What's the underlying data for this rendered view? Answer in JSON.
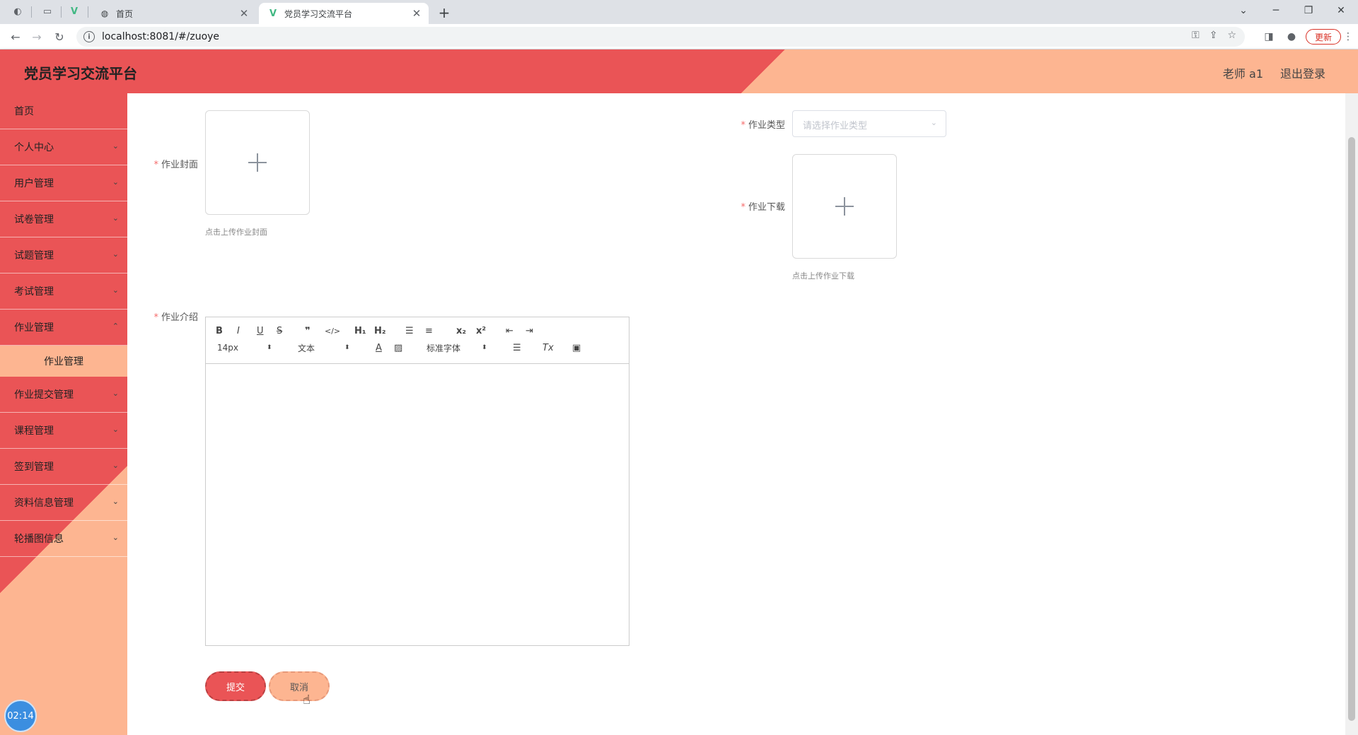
{
  "browser": {
    "tabs": [
      {
        "label": "首页",
        "icon": "globe-icon"
      },
      {
        "label": "党员学习交流平台",
        "icon": "vue-logo-icon",
        "active": true
      }
    ],
    "url": "localhost:8081/#/zuoye",
    "update_label": "更新"
  },
  "header": {
    "brand": "党员学习交流平台",
    "user": "老师 a1",
    "logout": "退出登录"
  },
  "sidebar": {
    "items": [
      {
        "label": "首页",
        "expandable": false
      },
      {
        "label": "个人中心",
        "expandable": true
      },
      {
        "label": "用户管理",
        "expandable": true
      },
      {
        "label": "试卷管理",
        "expandable": true
      },
      {
        "label": "试题管理",
        "expandable": true
      },
      {
        "label": "考试管理",
        "expandable": true
      },
      {
        "label": "作业管理",
        "expandable": true,
        "expanded": true
      },
      {
        "label": "作业提交管理",
        "expandable": true
      },
      {
        "label": "课程管理",
        "expandable": true
      },
      {
        "label": "签到管理",
        "expandable": true
      },
      {
        "label": "资料信息管理",
        "expandable": true
      },
      {
        "label": "轮播图信息",
        "expandable": true
      }
    ],
    "submenu": {
      "label": "作业管理"
    },
    "clock": "02:14"
  },
  "form": {
    "cover": {
      "required_mark": "*",
      "label": "作业封面",
      "hint": "点击上传作业封面"
    },
    "type": {
      "required_mark": "*",
      "label": "作业类型",
      "placeholder": "请选择作业类型"
    },
    "download": {
      "required_mark": "*",
      "label": "作业下载",
      "hint": "点击上传作业下载"
    },
    "intro": {
      "required_mark": "*",
      "label": "作业介绍"
    },
    "editor": {
      "font_size": "14px",
      "header": "文本",
      "font": "标准字体",
      "buttons": {
        "bold": "B",
        "italic": "I",
        "underline": "U",
        "strike": "S",
        "quote": "❞",
        "code": "</>",
        "h1": "H₁",
        "h2": "H₂",
        "sub": "x₂",
        "sup": "x²",
        "color": "A",
        "clean": "Tx"
      }
    },
    "submit_label": "提交",
    "cancel_label": "取消"
  },
  "colors": {
    "primary": "#ea5456",
    "secondary": "#fdb591"
  }
}
